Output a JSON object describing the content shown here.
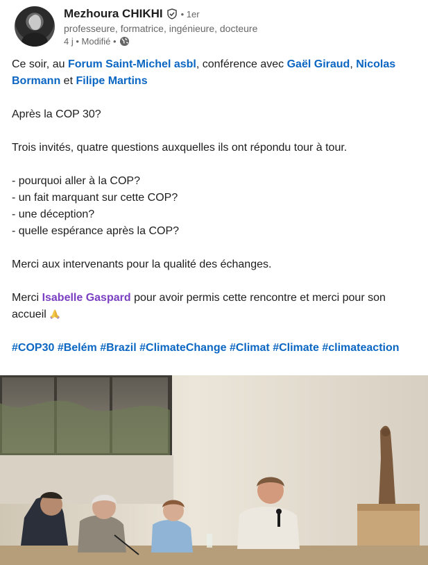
{
  "author": {
    "name": "Mezhoura CHIKHI",
    "degree": "• 1er",
    "headline": "professeure, formatrice, ingénieure, docteure",
    "time": "4 j • Modifié •",
    "verified_icon": "verified-shield-icon",
    "visibility_icon": "globe-icon"
  },
  "post": {
    "line1": {
      "p1": "Ce soir, au ",
      "forum": "Forum Saint-Michel asbl",
      "p2": ", conférence avec ",
      "gael": "Gaël Giraud",
      "p3": ", ",
      "nicolas": "Nicolas Bormann",
      "p4": " et ",
      "filipe": "Filipe Martins"
    },
    "question_title": "Après la COP 30?",
    "intro": "Trois invités, quatre questions auxquelles ils ont répondu tour à tour.",
    "questions": [
      "- pourquoi aller à la COP?",
      "- un fait marquant sur cette COP?",
      "- une déception?",
      "- quelle espérance après la COP?"
    ],
    "thanks": "Merci aux intervenants pour la qualité des échanges.",
    "merci": {
      "p1": "Merci ",
      "isabelle": "Isabelle Gaspard",
      "p2": " pour avoir permis cette rencontre et merci pour son accueil"
    },
    "emoji_icon": "praying-hands-icon",
    "hashtags": [
      "#COP30",
      "#Belém",
      "#Brazil",
      "#ClimateChange",
      "#Climat",
      "#Climate",
      "#climateaction"
    ]
  },
  "colors": {
    "link": "#0a66c2",
    "mention_purple": "#7a3fc2",
    "meta": "#666666",
    "text": "#1d1d1d"
  }
}
